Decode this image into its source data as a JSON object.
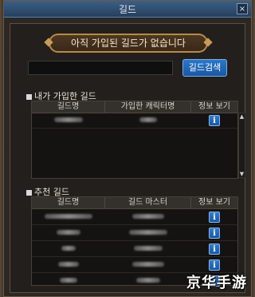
{
  "window": {
    "title": "길드",
    "close_label": "×"
  },
  "banner": {
    "text": "아직 가입된 길드가 없습니다"
  },
  "search": {
    "button_label": "길드검색",
    "value": ""
  },
  "my_guild": {
    "title": "내가 가입한 길드",
    "columns": [
      "길드명",
      "가입한 캐릭터명",
      "정보 보기"
    ]
  },
  "recommended": {
    "title": "추천 길드",
    "columns": [
      "길드명",
      "길드 마스터",
      "정보 보기"
    ]
  },
  "info_icon_label": "i",
  "scroll": {
    "up": "▲",
    "down": "▼"
  },
  "watermark": {
    "text": "京华手游"
  }
}
